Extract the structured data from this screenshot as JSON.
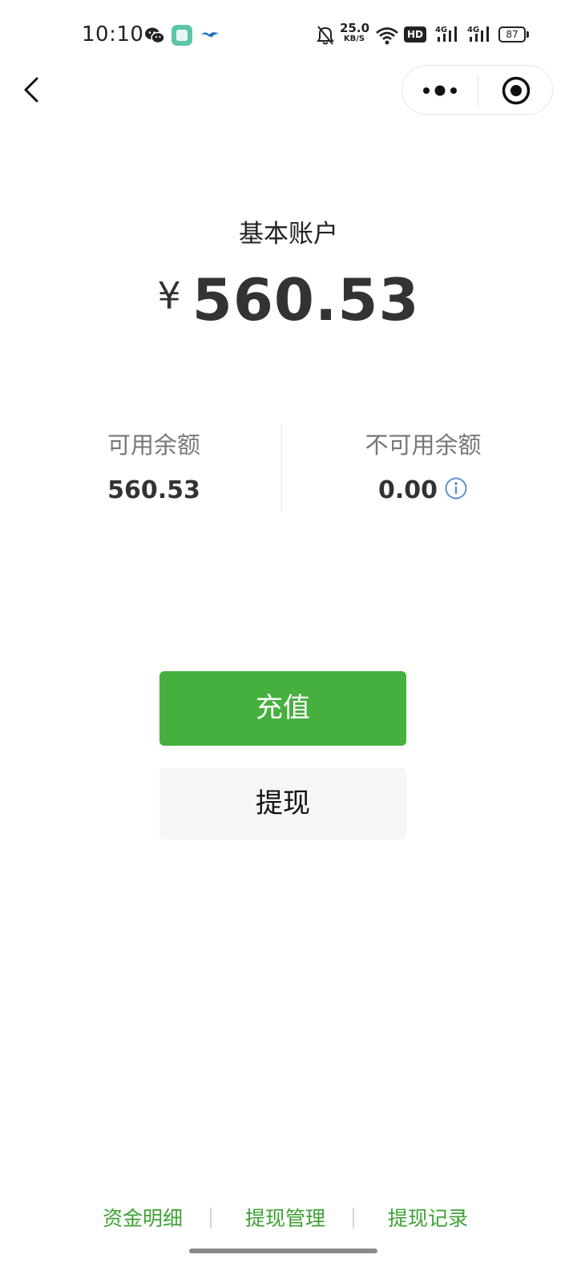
{
  "status_bar": {
    "time": "10:10",
    "net_speed": "25.0",
    "net_unit": "KB/S",
    "hd_label": "HD",
    "sig1_label": "4G",
    "sig2_label": "4G",
    "battery": "87",
    "icons": [
      "wechat-icon",
      "app-icon",
      "bird-icon",
      "mute-bell-icon",
      "wifi-icon",
      "signal-icon",
      "battery-icon"
    ]
  },
  "nav": {
    "back_icon": "back-chevron-icon",
    "more_icon": "more-icon",
    "close_icon": "close-miniprogram-icon"
  },
  "account": {
    "title": "基本账户",
    "currency": "¥",
    "total": "560.53"
  },
  "balances": {
    "available_label": "可用余额",
    "available_value": "560.53",
    "unavailable_label": "不可用余额",
    "unavailable_value": "0.00"
  },
  "actions": {
    "recharge": "充值",
    "withdraw": "提现"
  },
  "footer": {
    "links": [
      "资金明细",
      "提现管理",
      "提现记录"
    ]
  },
  "colors": {
    "accent_green": "#46b03f",
    "link_green": "#3ea235",
    "info_blue": "#5a8fd0"
  }
}
